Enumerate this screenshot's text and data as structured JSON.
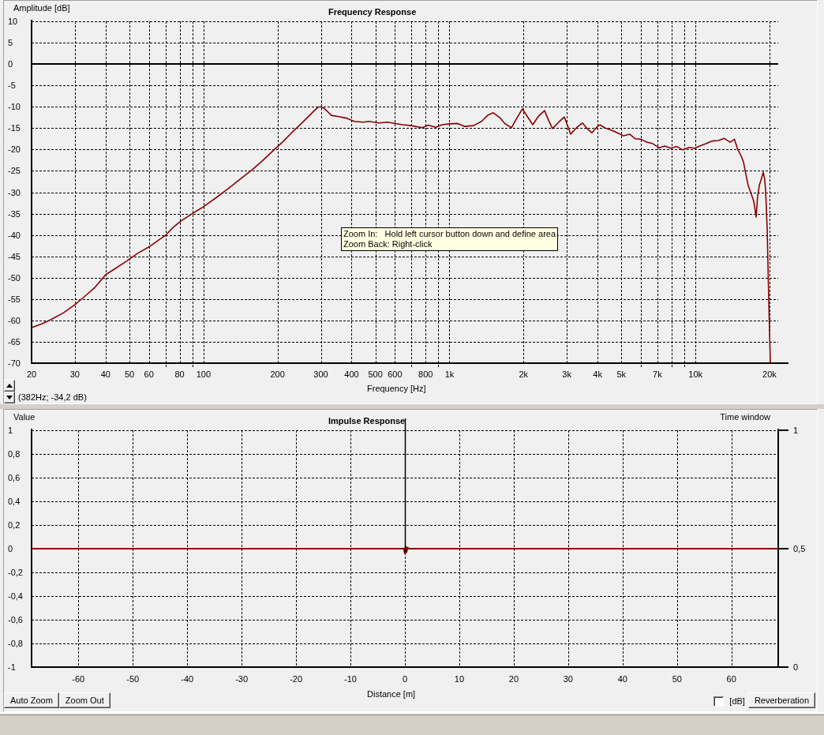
{
  "frequency_response": {
    "title": "Frequency Response",
    "ylabel": "Amplitude [dB]",
    "xlabel": "Frequency [Hz]",
    "y_tick_labels": [
      "10",
      "5",
      "0",
      "-5",
      "-10",
      "-15",
      "-20",
      "-25",
      "-30",
      "-35",
      "-40",
      "-45",
      "-50",
      "-55",
      "-60",
      "-65",
      "-70"
    ],
    "x_tick_labels": [
      "20",
      "30",
      "40",
      "50",
      "60",
      "80",
      "100",
      "200",
      "300",
      "400",
      "500",
      "600",
      "800",
      "1k",
      "2k",
      "3k",
      "4k",
      "5k",
      "7k",
      "10k",
      "20k"
    ],
    "tooltip": {
      "lines": [
        "Zoom In:   Hold left cursor button down and define area",
        "Zoom Back: Right-click"
      ]
    },
    "cursor_readout": "(382Hz; -34,2 dB)"
  },
  "impulse_response": {
    "chart_data": {
      "type": "line",
      "title": "Impulse Response",
      "xlabel": "Distance [m]",
      "ylabel": "Value",
      "y2label": "Time window",
      "grid": true,
      "x": [
        -68.6,
        -0.2,
        0,
        0.15,
        0.3,
        0.5,
        0.8,
        68.6
      ],
      "series": [
        {
          "color": "#8b0000",
          "values": [
            0,
            0,
            -0.04,
            0.02,
            -0.03,
            0.01,
            0,
            0
          ]
        }
      ],
      "xlim": [
        -68.6,
        68.6
      ],
      "ylim": [
        -1,
        1
      ],
      "y2lim": [
        0,
        1
      ],
      "xticks": [
        -60,
        -50,
        -40,
        -30,
        -20,
        -10,
        0,
        10,
        20,
        30,
        40,
        50,
        60
      ],
      "yticks": [
        1,
        {
          "value": 0.8,
          "label": "0,8"
        },
        {
          "value": 0.6,
          "label": "0,6"
        },
        {
          "value": 0.4,
          "label": "0,4"
        },
        {
          "value": 0.2,
          "label": "0,2"
        },
        0,
        {
          "value": -0.2,
          "label": "-0,2"
        },
        {
          "value": -0.4,
          "label": "-0,4"
        },
        {
          "value": -0.6,
          "label": "-0,6"
        },
        {
          "value": -0.8,
          "label": "-0,8"
        },
        -1
      ],
      "y2ticks": [
        1,
        {
          "value": 0.5,
          "label": "0,5"
        },
        0
      ],
      "ref_lines": [
        {
          "axis": "x",
          "value": 0,
          "color": "#000000"
        }
      ]
    },
    "buttons": [
      "Auto Zoom",
      "Zoom Out"
    ],
    "db_checkbox": {
      "label": "[dB]",
      "checked": false
    },
    "reverberation_button": "Reverberation"
  }
}
